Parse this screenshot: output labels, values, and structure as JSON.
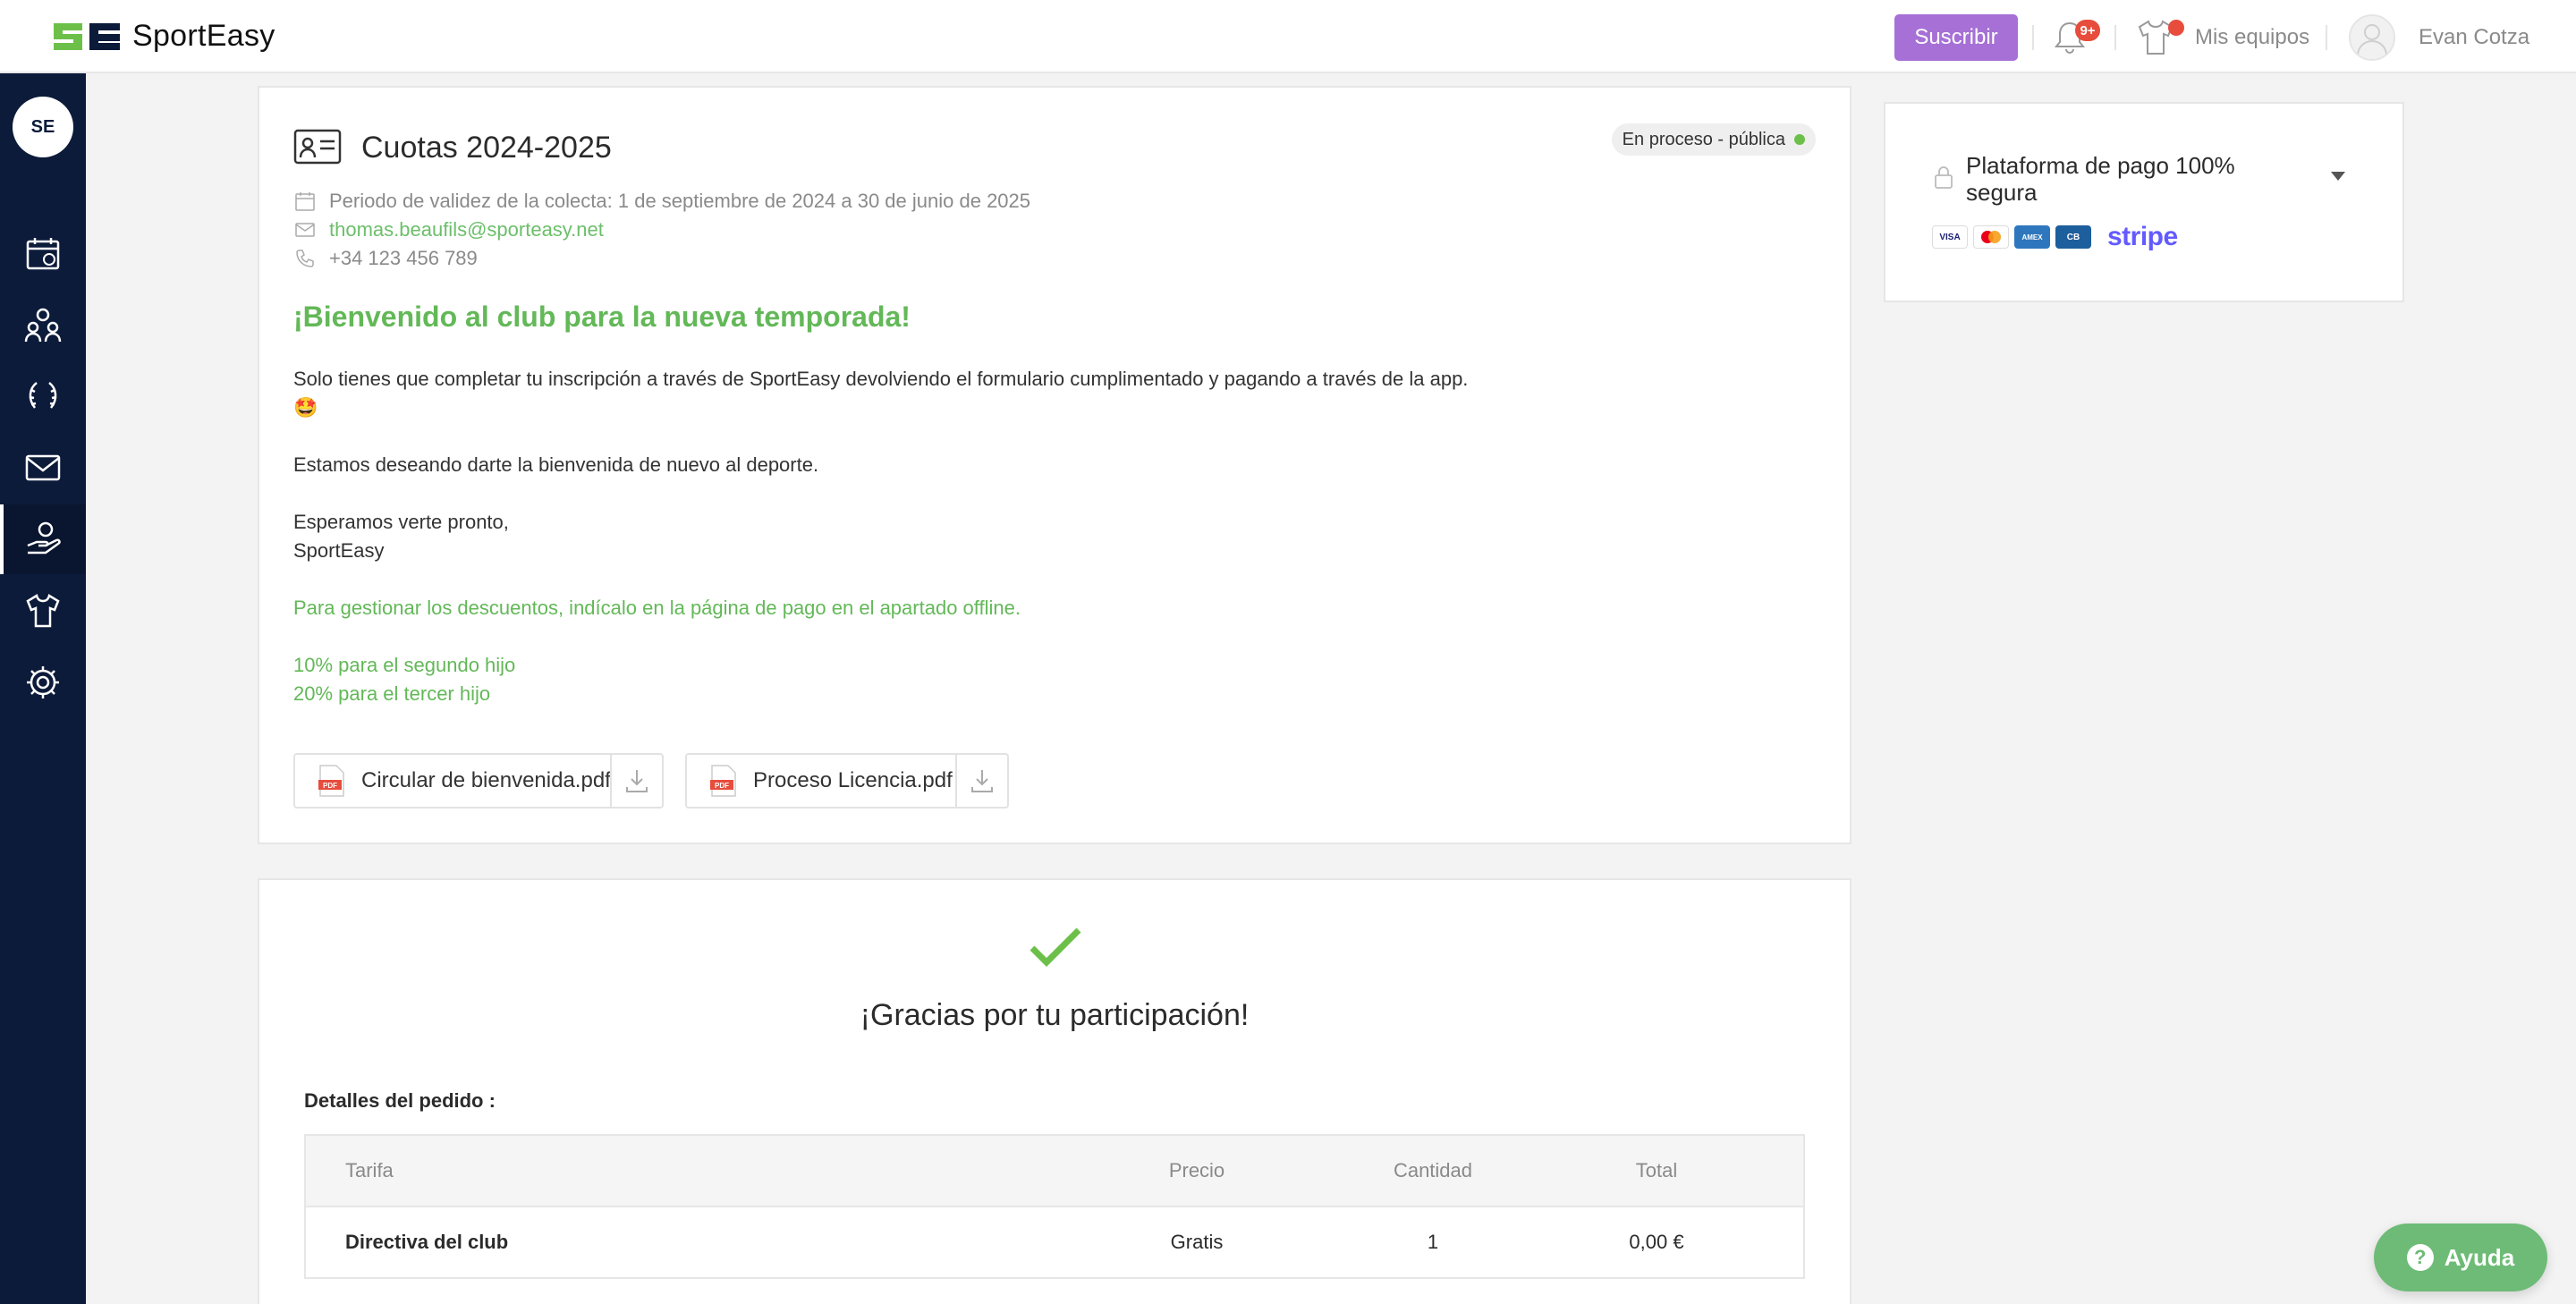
{
  "app": {
    "brand_name": "SportEasy",
    "brand_colors": {
      "navy": "#0c1b3a",
      "green": "#6cc04a"
    }
  },
  "header": {
    "subscribe_label": "Suscribir",
    "notifications_badge": "9+",
    "teams_label": "Mis equipos",
    "user_name": "Evan Cotza"
  },
  "sidebar": {
    "logo_text": "SE",
    "items": [
      {
        "icon": "calendar-icon"
      },
      {
        "icon": "members-icon"
      },
      {
        "icon": "laurel-icon"
      },
      {
        "icon": "mail-icon"
      },
      {
        "icon": "hand-coin-icon",
        "active": true
      },
      {
        "icon": "jersey-icon"
      },
      {
        "icon": "gear-icon"
      }
    ]
  },
  "collection": {
    "title": "Cuotas 2024-2025",
    "status": "En proceso - pública",
    "period": "Periodo de validez de la colecta: 1 de septiembre de 2024 a 30 de junio de 2025",
    "email": "thomas.beaufils@sporteasy.net",
    "phone": "+34 123 456 789",
    "welcome": "¡Bienvenido al club para la nueva temporada!",
    "paragraph1": "Solo tienes que completar tu inscripción a través de SportEasy devolviendo el formulario cumplimentado y pagando a través de la app.",
    "emoji": "🤩",
    "paragraph2": "Estamos deseando darte la bienvenida de nuevo al deporte.",
    "closing1": "Esperamos verte pronto,",
    "closing2": "SportEasy",
    "discount_note": "Para gestionar los descuentos, indícalo en la página de pago en el apartado offline.",
    "discount1": "10% para el segundo hijo",
    "discount2": "20% para el tercer hijo",
    "attachments": [
      {
        "name": "Circular de bienvenida.pdf"
      },
      {
        "name": "Proceso Licencia.pdf"
      }
    ]
  },
  "payment": {
    "title": "Plataforma de pago 100% segura",
    "cards": [
      "VISA",
      "mastercard",
      "AMEX",
      "CB"
    ],
    "provider": "stripe"
  },
  "thanks": {
    "title": "¡Gracias por tu participación!",
    "details_label": "Detalles del pedido :",
    "table": {
      "headers": {
        "tarifa": "Tarifa",
        "precio": "Precio",
        "cantidad": "Cantidad",
        "total": "Total"
      },
      "rows": [
        {
          "tarifa": "Directiva del club",
          "precio": "Gratis",
          "cantidad": "1",
          "total": "0,00 €"
        }
      ]
    }
  },
  "help": {
    "label": "Ayuda"
  }
}
